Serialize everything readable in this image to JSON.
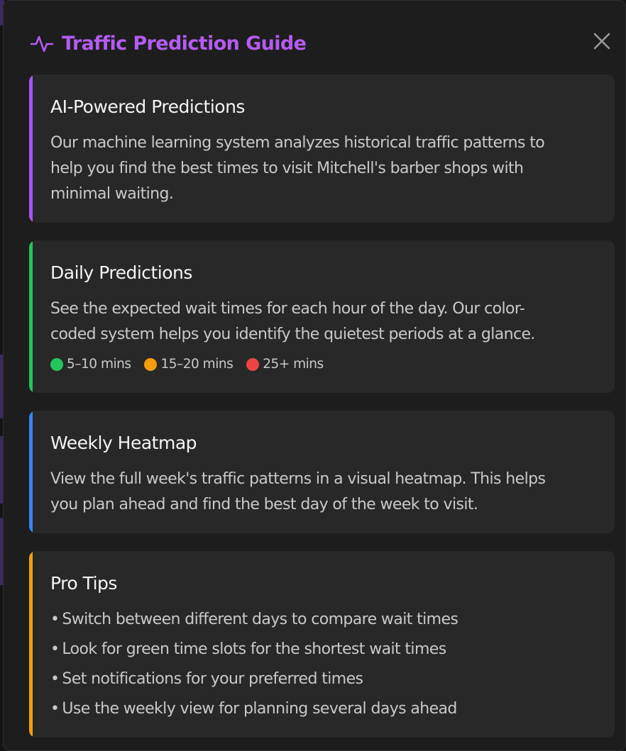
{
  "modal": {
    "title": "Traffic Prediction Guide",
    "header_icon": "activity-pulse-icon",
    "close_icon": "close-icon"
  },
  "colors": {
    "title": "#b35cf2",
    "card_background": "#282828",
    "accent_purple": "#a855f7",
    "accent_green": "#22c55e",
    "accent_blue": "#3b82f6",
    "accent_orange": "#f59e0b",
    "legend_green": "#22c55e",
    "legend_orange": "#f59e0b",
    "legend_red": "#ef4444"
  },
  "cards": {
    "ai": {
      "title": "AI-Powered Predictions",
      "body_line1": "Our machine learning system analyzes historical traffic patterns to",
      "body_line2": "help you find the best times to visit Mitchell's barber shops with",
      "body_line3": "minimal waiting."
    },
    "daily": {
      "title": "Daily Predictions",
      "body_line1": "See the expected wait times for each hour of the day. Our color-",
      "body_line2": "coded system helps you identify the quietest periods at a glance.",
      "legend": [
        {
          "label": "5–10 mins",
          "color": "#22c55e"
        },
        {
          "label": "15–20 mins",
          "color": "#f59e0b"
        },
        {
          "label": "25+ mins",
          "color": "#ef4444"
        }
      ]
    },
    "weekly": {
      "title": "Weekly Heatmap",
      "body_line1": "View the full week's traffic patterns in a visual heatmap. This helps",
      "body_line2": "you plan ahead and find the best day of the week to visit."
    },
    "tips": {
      "title": "Pro Tips",
      "items": [
        "Switch between different days to compare wait times",
        "Look for green time slots for the shortest wait times",
        "Set notifications for your preferred times",
        "Use the weekly view for planning several days ahead"
      ]
    }
  }
}
